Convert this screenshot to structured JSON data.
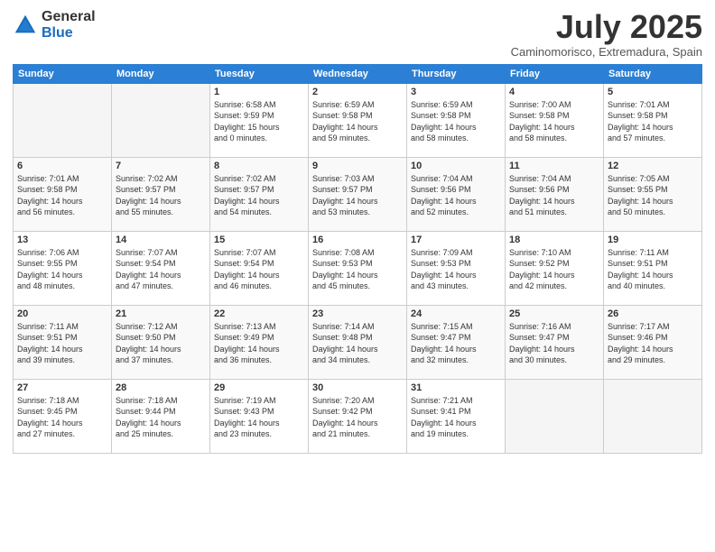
{
  "header": {
    "logo_general": "General",
    "logo_blue": "Blue",
    "month_title": "July 2025",
    "location": "Caminomorisco, Extremadura, Spain"
  },
  "weekdays": [
    "Sunday",
    "Monday",
    "Tuesday",
    "Wednesday",
    "Thursday",
    "Friday",
    "Saturday"
  ],
  "weeks": [
    [
      {
        "day": "",
        "info": ""
      },
      {
        "day": "",
        "info": ""
      },
      {
        "day": "1",
        "info": "Sunrise: 6:58 AM\nSunset: 9:59 PM\nDaylight: 15 hours\nand 0 minutes."
      },
      {
        "day": "2",
        "info": "Sunrise: 6:59 AM\nSunset: 9:58 PM\nDaylight: 14 hours\nand 59 minutes."
      },
      {
        "day": "3",
        "info": "Sunrise: 6:59 AM\nSunset: 9:58 PM\nDaylight: 14 hours\nand 58 minutes."
      },
      {
        "day": "4",
        "info": "Sunrise: 7:00 AM\nSunset: 9:58 PM\nDaylight: 14 hours\nand 58 minutes."
      },
      {
        "day": "5",
        "info": "Sunrise: 7:01 AM\nSunset: 9:58 PM\nDaylight: 14 hours\nand 57 minutes."
      }
    ],
    [
      {
        "day": "6",
        "info": "Sunrise: 7:01 AM\nSunset: 9:58 PM\nDaylight: 14 hours\nand 56 minutes."
      },
      {
        "day": "7",
        "info": "Sunrise: 7:02 AM\nSunset: 9:57 PM\nDaylight: 14 hours\nand 55 minutes."
      },
      {
        "day": "8",
        "info": "Sunrise: 7:02 AM\nSunset: 9:57 PM\nDaylight: 14 hours\nand 54 minutes."
      },
      {
        "day": "9",
        "info": "Sunrise: 7:03 AM\nSunset: 9:57 PM\nDaylight: 14 hours\nand 53 minutes."
      },
      {
        "day": "10",
        "info": "Sunrise: 7:04 AM\nSunset: 9:56 PM\nDaylight: 14 hours\nand 52 minutes."
      },
      {
        "day": "11",
        "info": "Sunrise: 7:04 AM\nSunset: 9:56 PM\nDaylight: 14 hours\nand 51 minutes."
      },
      {
        "day": "12",
        "info": "Sunrise: 7:05 AM\nSunset: 9:55 PM\nDaylight: 14 hours\nand 50 minutes."
      }
    ],
    [
      {
        "day": "13",
        "info": "Sunrise: 7:06 AM\nSunset: 9:55 PM\nDaylight: 14 hours\nand 48 minutes."
      },
      {
        "day": "14",
        "info": "Sunrise: 7:07 AM\nSunset: 9:54 PM\nDaylight: 14 hours\nand 47 minutes."
      },
      {
        "day": "15",
        "info": "Sunrise: 7:07 AM\nSunset: 9:54 PM\nDaylight: 14 hours\nand 46 minutes."
      },
      {
        "day": "16",
        "info": "Sunrise: 7:08 AM\nSunset: 9:53 PM\nDaylight: 14 hours\nand 45 minutes."
      },
      {
        "day": "17",
        "info": "Sunrise: 7:09 AM\nSunset: 9:53 PM\nDaylight: 14 hours\nand 43 minutes."
      },
      {
        "day": "18",
        "info": "Sunrise: 7:10 AM\nSunset: 9:52 PM\nDaylight: 14 hours\nand 42 minutes."
      },
      {
        "day": "19",
        "info": "Sunrise: 7:11 AM\nSunset: 9:51 PM\nDaylight: 14 hours\nand 40 minutes."
      }
    ],
    [
      {
        "day": "20",
        "info": "Sunrise: 7:11 AM\nSunset: 9:51 PM\nDaylight: 14 hours\nand 39 minutes."
      },
      {
        "day": "21",
        "info": "Sunrise: 7:12 AM\nSunset: 9:50 PM\nDaylight: 14 hours\nand 37 minutes."
      },
      {
        "day": "22",
        "info": "Sunrise: 7:13 AM\nSunset: 9:49 PM\nDaylight: 14 hours\nand 36 minutes."
      },
      {
        "day": "23",
        "info": "Sunrise: 7:14 AM\nSunset: 9:48 PM\nDaylight: 14 hours\nand 34 minutes."
      },
      {
        "day": "24",
        "info": "Sunrise: 7:15 AM\nSunset: 9:47 PM\nDaylight: 14 hours\nand 32 minutes."
      },
      {
        "day": "25",
        "info": "Sunrise: 7:16 AM\nSunset: 9:47 PM\nDaylight: 14 hours\nand 30 minutes."
      },
      {
        "day": "26",
        "info": "Sunrise: 7:17 AM\nSunset: 9:46 PM\nDaylight: 14 hours\nand 29 minutes."
      }
    ],
    [
      {
        "day": "27",
        "info": "Sunrise: 7:18 AM\nSunset: 9:45 PM\nDaylight: 14 hours\nand 27 minutes."
      },
      {
        "day": "28",
        "info": "Sunrise: 7:18 AM\nSunset: 9:44 PM\nDaylight: 14 hours\nand 25 minutes."
      },
      {
        "day": "29",
        "info": "Sunrise: 7:19 AM\nSunset: 9:43 PM\nDaylight: 14 hours\nand 23 minutes."
      },
      {
        "day": "30",
        "info": "Sunrise: 7:20 AM\nSunset: 9:42 PM\nDaylight: 14 hours\nand 21 minutes."
      },
      {
        "day": "31",
        "info": "Sunrise: 7:21 AM\nSunset: 9:41 PM\nDaylight: 14 hours\nand 19 minutes."
      },
      {
        "day": "",
        "info": ""
      },
      {
        "day": "",
        "info": ""
      }
    ]
  ]
}
